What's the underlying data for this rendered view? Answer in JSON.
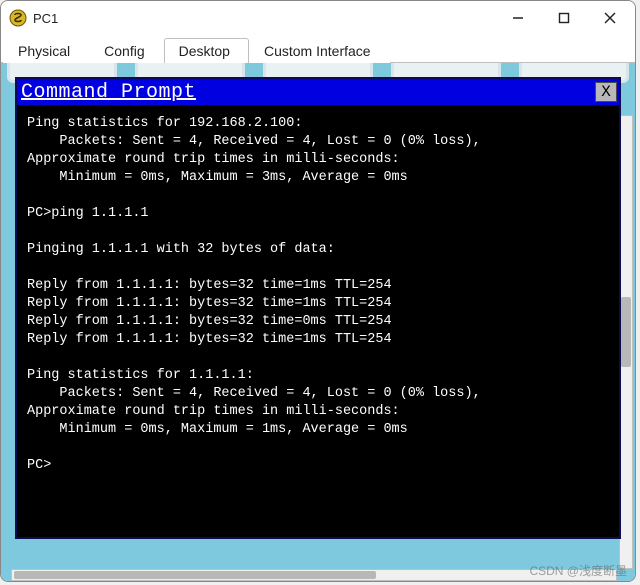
{
  "window": {
    "title": "PC1"
  },
  "tabs": {
    "items": [
      {
        "label": "Physical"
      },
      {
        "label": "Config"
      },
      {
        "label": "Desktop"
      },
      {
        "label": "Custom Interface"
      }
    ],
    "active_index": 2
  },
  "cmd": {
    "title": "Command Prompt",
    "close_label": "X"
  },
  "terminal": {
    "lines": [
      "Ping statistics for 192.168.2.100:",
      "    Packets: Sent = 4, Received = 4, Lost = 0 (0% loss),",
      "Approximate round trip times in milli-seconds:",
      "    Minimum = 0ms, Maximum = 3ms, Average = 0ms",
      "",
      "PC>ping 1.1.1.1",
      "",
      "Pinging 1.1.1.1 with 32 bytes of data:",
      "",
      "Reply from 1.1.1.1: bytes=32 time=1ms TTL=254",
      "Reply from 1.1.1.1: bytes=32 time=1ms TTL=254",
      "Reply from 1.1.1.1: bytes=32 time=0ms TTL=254",
      "Reply from 1.1.1.1: bytes=32 time=1ms TTL=254",
      "",
      "Ping statistics for 1.1.1.1:",
      "    Packets: Sent = 4, Received = 4, Lost = 0 (0% loss),",
      "Approximate round trip times in milli-seconds:",
      "    Minimum = 0ms, Maximum = 1ms, Average = 0ms",
      "",
      "PC>"
    ]
  },
  "watermark": "CSDN @浅度断墨"
}
